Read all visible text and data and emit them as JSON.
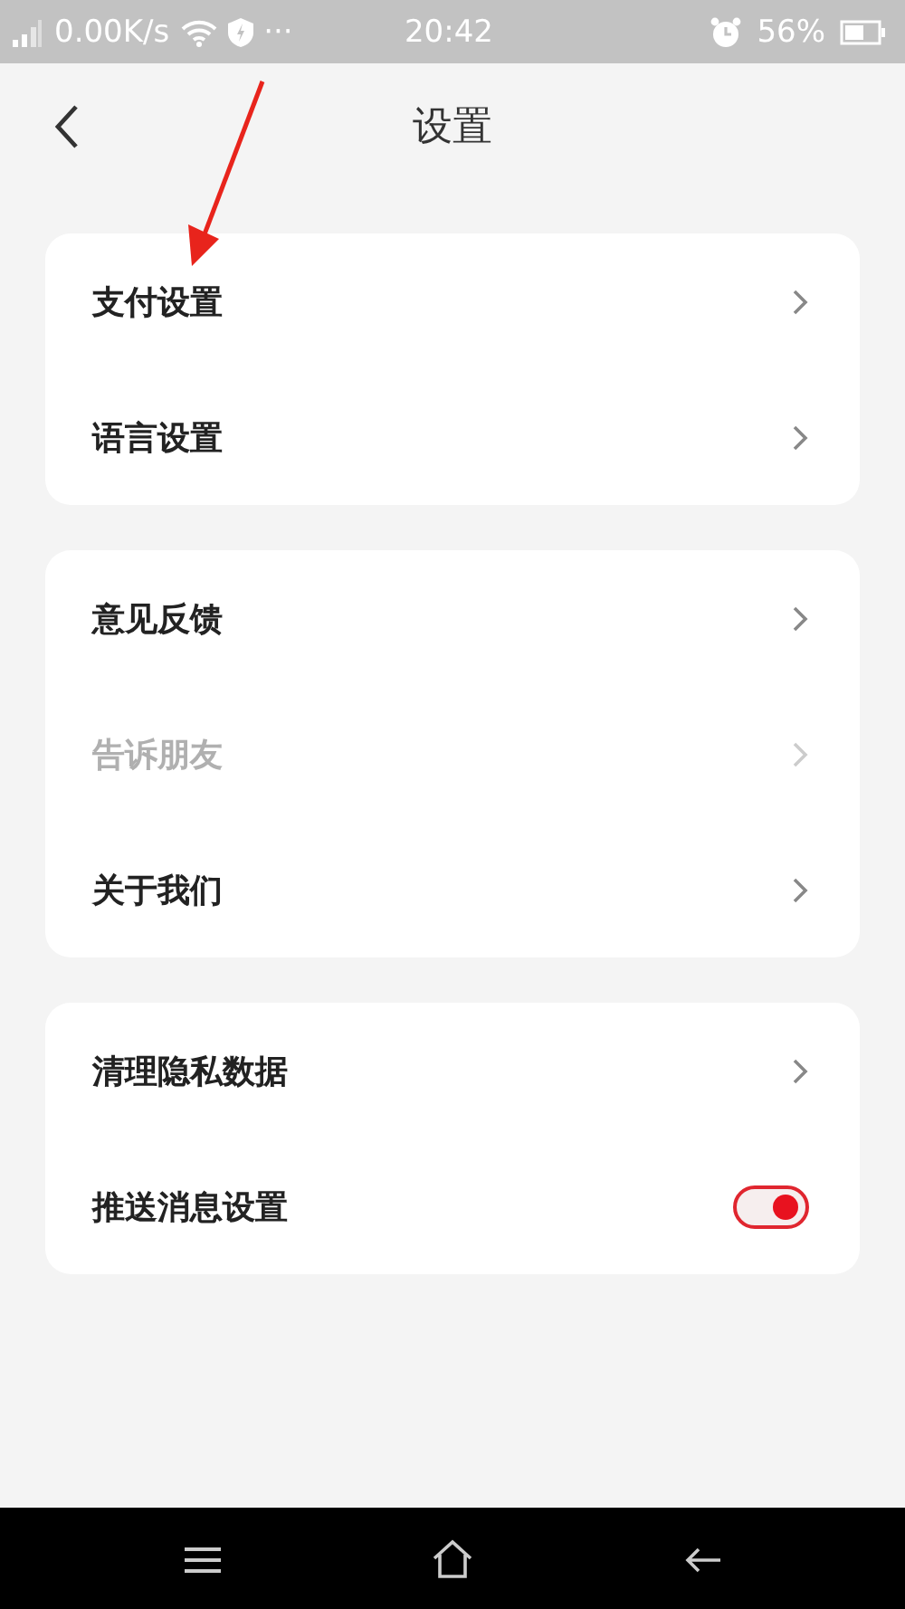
{
  "status_bar": {
    "speed": "0.00K/s",
    "more": "···",
    "time": "20:42",
    "battery": "56%"
  },
  "header": {
    "title": "设置"
  },
  "groups": [
    {
      "items": [
        {
          "kind": "link",
          "label": "支付设置",
          "disabled": false
        },
        {
          "kind": "link",
          "label": "语言设置",
          "disabled": false
        }
      ]
    },
    {
      "items": [
        {
          "kind": "link",
          "label": "意见反馈",
          "disabled": false
        },
        {
          "kind": "link",
          "label": "告诉朋友",
          "disabled": true
        },
        {
          "kind": "link",
          "label": "关于我们",
          "disabled": false
        }
      ]
    },
    {
      "items": [
        {
          "kind": "link",
          "label": "清理隐私数据",
          "disabled": false
        },
        {
          "kind": "switch",
          "label": "推送消息设置",
          "disabled": false,
          "on": true
        }
      ]
    }
  ]
}
